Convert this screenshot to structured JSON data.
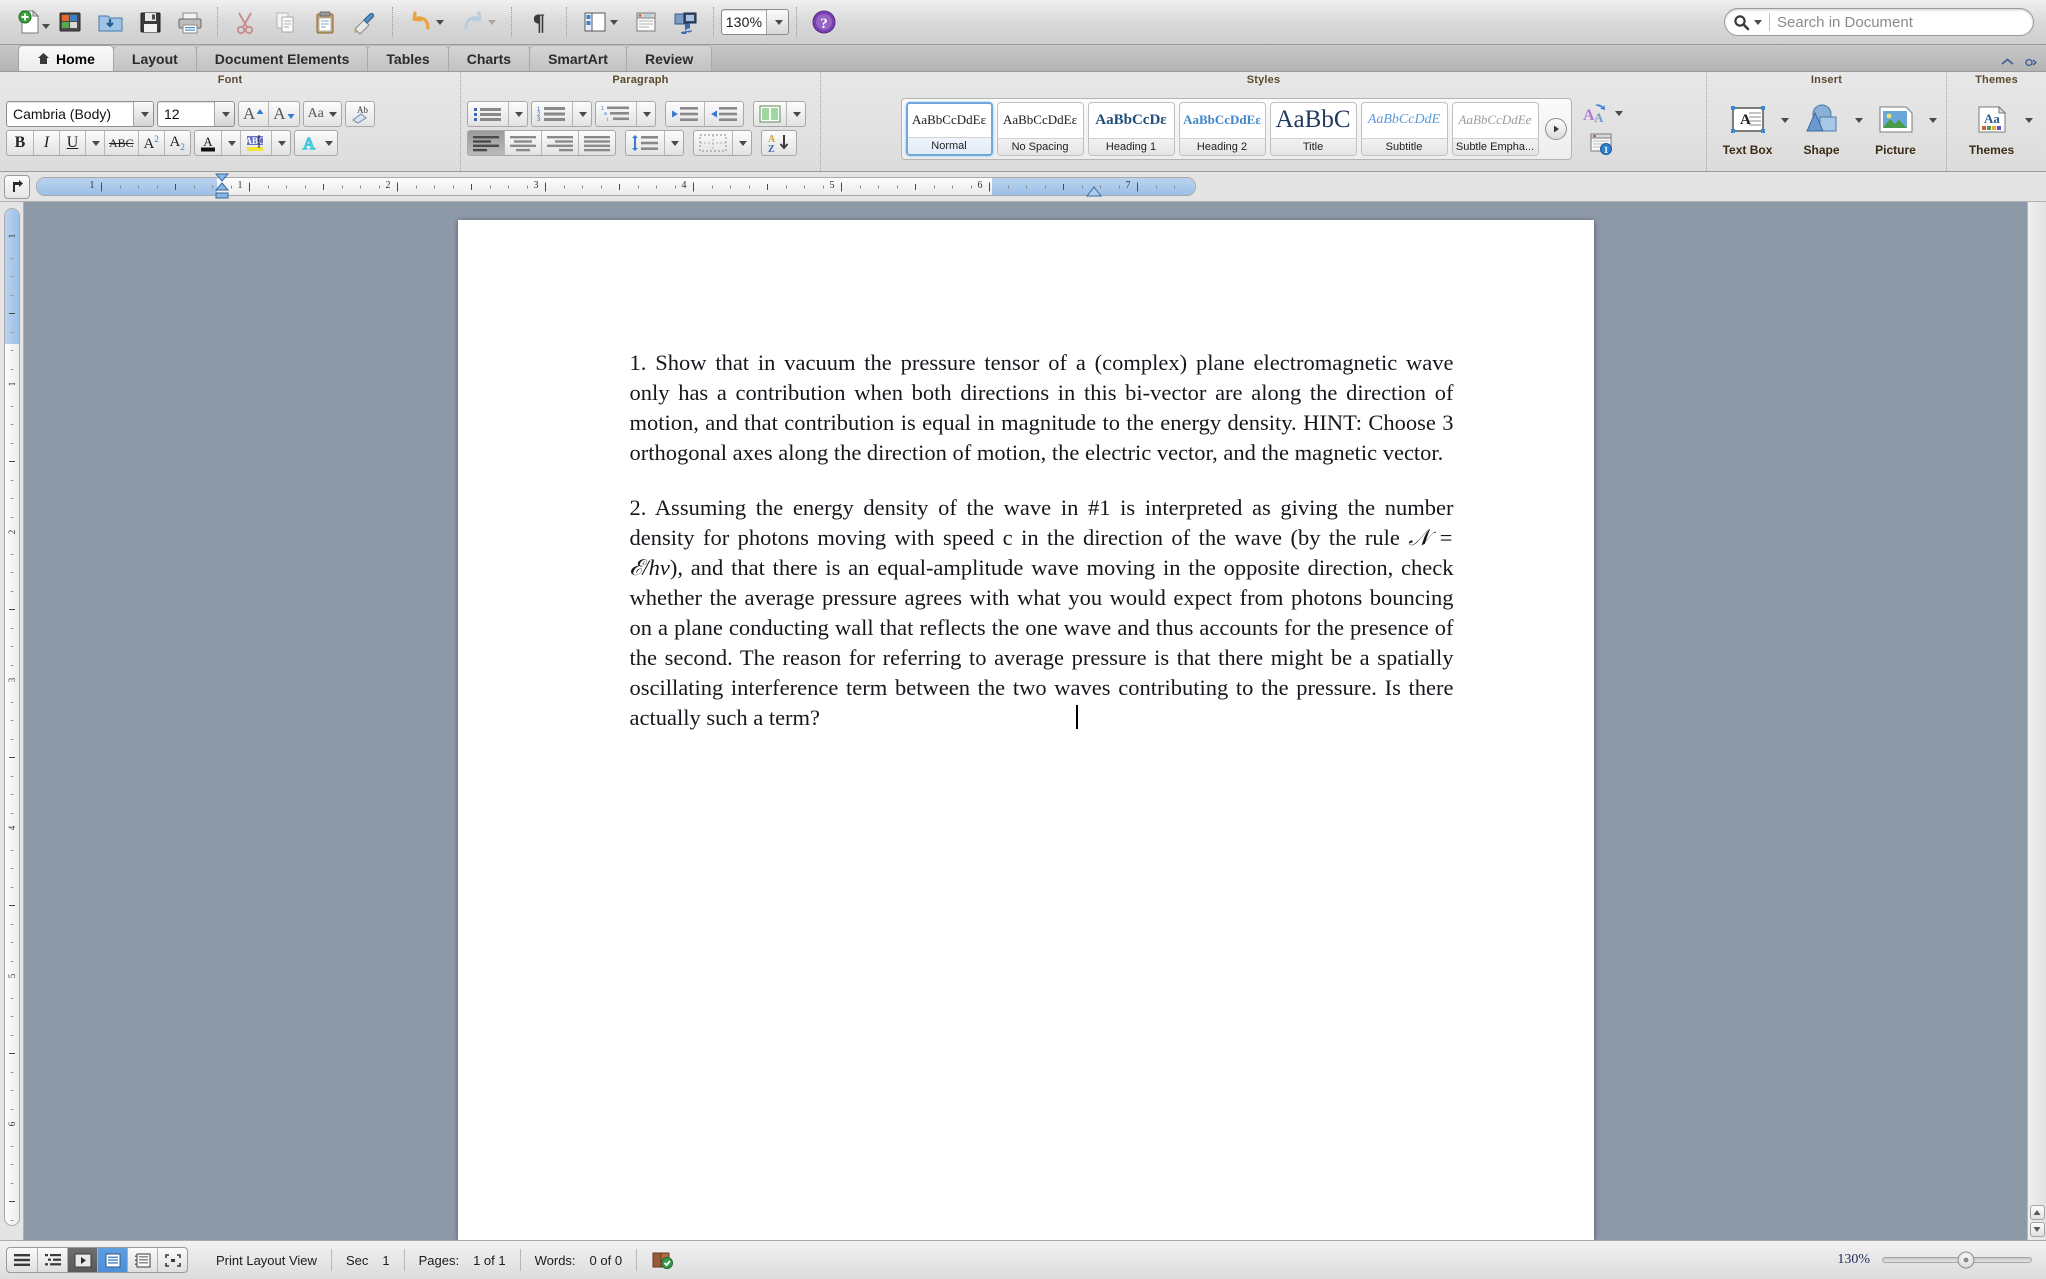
{
  "app": {
    "name": "Microsoft Word",
    "zoom_toolbar": "130%",
    "zoom_status": "130%"
  },
  "search": {
    "placeholder": "Search in Document",
    "value": "",
    "icon": "search-icon"
  },
  "toolbar": {
    "items": [
      {
        "name": "new-document-button",
        "icon": "new-document-icon",
        "has_menu": true
      },
      {
        "name": "open-recent-button",
        "icon": "media-browser-icon",
        "has_menu": false
      },
      {
        "name": "open-button",
        "icon": "open-folder-icon",
        "has_menu": false
      },
      {
        "name": "save-button",
        "icon": "save-floppy-icon",
        "has_menu": false
      },
      {
        "name": "print-button",
        "icon": "printer-icon",
        "has_menu": false
      },
      {
        "name": "cut-button",
        "icon": "scissors-icon",
        "has_menu": false
      },
      {
        "name": "copy-button",
        "icon": "copy-icon",
        "has_menu": false
      },
      {
        "name": "paste-button",
        "icon": "clipboard-icon",
        "has_menu": false
      },
      {
        "name": "format-painter-button",
        "icon": "paintbrush-icon",
        "has_menu": false
      },
      {
        "name": "undo-button",
        "icon": "undo-arrow-icon",
        "has_menu": true
      },
      {
        "name": "redo-button",
        "icon": "redo-arrow-icon",
        "has_menu": true
      },
      {
        "name": "show-formatting-button",
        "icon": "pilcrow-icon",
        "has_menu": false
      },
      {
        "name": "sidebar-button",
        "icon": "sidebar-panel-icon",
        "has_menu": true
      },
      {
        "name": "toolbox-button",
        "icon": "toolbox-icon",
        "has_menu": false
      },
      {
        "name": "media-browser-button",
        "icon": "media-browser-icon",
        "has_menu": false
      },
      {
        "name": "help-button",
        "icon": "help-question-icon",
        "has_menu": false
      }
    ]
  },
  "ribbon": {
    "tabs": [
      {
        "label": "Home",
        "active": true,
        "icon": "home-icon"
      },
      {
        "label": "Layout",
        "active": false
      },
      {
        "label": "Document Elements",
        "active": false
      },
      {
        "label": "Tables",
        "active": false
      },
      {
        "label": "Charts",
        "active": false
      },
      {
        "label": "SmartArt",
        "active": false
      },
      {
        "label": "Review",
        "active": false
      }
    ],
    "collapse_icon": "chevron-up-icon",
    "options_icon": "gear-icon",
    "groups": {
      "font": {
        "title": "Font",
        "font_name": "Cambria (Body)",
        "font_size": "12",
        "buttons": [
          {
            "name": "grow-font-button",
            "label": "A"
          },
          {
            "name": "shrink-font-button",
            "label": "A"
          },
          {
            "name": "change-case-button",
            "label": "Aa"
          },
          {
            "name": "clear-formatting-button",
            "label": "Ab"
          },
          {
            "name": "bold-button",
            "label": "B"
          },
          {
            "name": "italic-button",
            "label": "I"
          },
          {
            "name": "underline-button",
            "label": "U"
          },
          {
            "name": "strikethrough-button",
            "label": "ABC"
          },
          {
            "name": "superscript-button",
            "label": "A2"
          },
          {
            "name": "subscript-button",
            "label": "A2"
          },
          {
            "name": "font-color-button",
            "label": "A"
          },
          {
            "name": "highlight-button",
            "label": "ABC"
          },
          {
            "name": "text-effects-button",
            "label": "A"
          }
        ]
      },
      "paragraph": {
        "title": "Paragraph",
        "buttons": [
          {
            "name": "bulleted-list-button"
          },
          {
            "name": "numbered-list-button"
          },
          {
            "name": "multilevel-list-button"
          },
          {
            "name": "decrease-indent-button"
          },
          {
            "name": "increase-indent-button"
          },
          {
            "name": "columns-button"
          },
          {
            "name": "align-left-button"
          },
          {
            "name": "align-center-button"
          },
          {
            "name": "align-right-button"
          },
          {
            "name": "justify-button"
          },
          {
            "name": "line-spacing-button"
          },
          {
            "name": "borders-button"
          },
          {
            "name": "sort-button"
          }
        ]
      },
      "styles": {
        "title": "Styles",
        "tiles": [
          {
            "preview": "AaBbCcDdEε",
            "label": "Normal",
            "selected": true,
            "style": "serif-plain"
          },
          {
            "preview": "AaBbCcDdEε",
            "label": "No Spacing",
            "selected": false,
            "style": "serif-plain"
          },
          {
            "preview": "AaBbCcDε",
            "label": "Heading 1",
            "selected": false,
            "style": "heading1"
          },
          {
            "preview": "AaBbCcDdEε",
            "label": "Heading 2",
            "selected": false,
            "style": "heading2"
          },
          {
            "preview": "AaBbC",
            "label": "Title",
            "selected": false,
            "style": "title"
          },
          {
            "preview": "AaBbCcDdE",
            "label": "Subtitle",
            "selected": false,
            "style": "subtitle"
          },
          {
            "preview": "AaBbCcDdEe",
            "label": "Subtle Empha...",
            "selected": false,
            "style": "subtle"
          }
        ],
        "more_icon": "play-circle-icon",
        "side_buttons": [
          {
            "name": "styles-pane-button",
            "icon": "double-a-icon"
          },
          {
            "name": "manage-styles-button",
            "icon": "styles-window-icon"
          }
        ]
      },
      "insert": {
        "title": "Insert",
        "items": [
          {
            "label": "Text Box",
            "name": "insert-text-box-button",
            "icon": "text-box-icon"
          },
          {
            "label": "Shape",
            "name": "insert-shape-button",
            "icon": "shape-icon"
          },
          {
            "label": "Picture",
            "name": "insert-picture-button",
            "icon": "picture-icon"
          }
        ]
      },
      "themes": {
        "title": "Themes",
        "items": [
          {
            "label": "Themes",
            "name": "themes-button",
            "icon": "themes-icon"
          }
        ]
      }
    }
  },
  "ruler": {
    "tab_selector_icon": "tab-stop-icon",
    "horizontal_labels": [
      "1",
      "1",
      "2",
      "3",
      "4",
      "5",
      "6",
      "7"
    ],
    "vertical_labels": [
      "1",
      "1",
      "2",
      "3",
      "4",
      "5",
      "6"
    ],
    "left_indent_icon": "indent-marker-icon",
    "right_indent_icon": "indent-marker-icon"
  },
  "document": {
    "paragraphs": [
      {
        "id": "problem-1",
        "segments": [
          {
            "type": "text",
            "value": "1. Show that in vacuum the pressure tensor of a (complex) plane electromagnetic wave only has a contribution when both directions in this bi-vector are along the direction of motion, and that contribution is equal in magnitude to the energy density.  HINT: Choose 3 orthogonal axes along the direction of motion, the electric vector, and the magnetic vector."
          }
        ]
      },
      {
        "id": "problem-2",
        "segments": [
          {
            "type": "text",
            "value": "2.  Assuming the energy density of the wave in #1 is interpreted as giving the number density for photons moving with speed c in the direction of the wave (by the rule "
          },
          {
            "type": "math",
            "value": "𝒩 = ℰ/hν"
          },
          {
            "type": "text",
            "value": "), and that there is an equal-amplitude wave moving in the opposite direction, check whether the average pressure agrees with what you would expect from photons bouncing on a plane conducting wall that reflects the one wave and thus accounts for the presence of the second.  The reason for referring to average pressure is that there might be a spatially oscillating interference term between the two waves contributing to the pressure.  Is there actually such a term?"
          }
        ]
      }
    ],
    "caret_visible": true
  },
  "status": {
    "view_buttons": [
      {
        "name": "draft-view-button",
        "icon": "draft-view-icon",
        "active": false
      },
      {
        "name": "outline-view-button",
        "icon": "outline-view-icon",
        "active": false
      },
      {
        "name": "publishing-view-button",
        "icon": "publishing-view-icon",
        "active": false,
        "dark": true
      },
      {
        "name": "print-layout-view-button",
        "icon": "print-layout-icon",
        "active": true
      },
      {
        "name": "notebook-view-button",
        "icon": "notebook-view-icon",
        "active": false
      },
      {
        "name": "full-screen-view-button",
        "icon": "full-screen-icon",
        "active": false
      }
    ],
    "view_label": "Print Layout View",
    "section_label": "Sec",
    "section_value": "1",
    "pages_label": "Pages:",
    "pages_value": "1 of 1",
    "words_label": "Words:",
    "words_value": "0 of 0",
    "spellcheck_icon": "spellcheck-book-icon"
  },
  "colors": {
    "accent_blue": "#4e8ed6",
    "heading_blue": "#1f4e79",
    "page_bg": "#8e99a8",
    "ribbon_bg": "#e2e2e2",
    "group_title": "#5b4a2e"
  }
}
